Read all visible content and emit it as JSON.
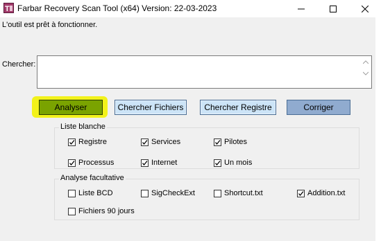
{
  "window": {
    "title": "Farbar Recovery Scan Tool (x64) Version: 22-03-2023",
    "icon": "frst-app-icon",
    "controls": [
      "minimize-icon",
      "maximize-icon",
      "close-icon"
    ]
  },
  "status_text": "L'outil est prêt à fonctionner.",
  "search": {
    "label": "Chercher:",
    "value": ""
  },
  "buttons": {
    "scan": "Analyser",
    "search_files": "Chercher Fichiers",
    "search_registry": "Chercher Registre",
    "fix": "Corriger"
  },
  "whitelist": {
    "title": "Liste blanche",
    "items": [
      {
        "label": "Registre",
        "checked": true
      },
      {
        "label": "Services",
        "checked": true
      },
      {
        "label": "Pilotes",
        "checked": true
      },
      {
        "label": "Processus",
        "checked": true
      },
      {
        "label": "Internet",
        "checked": true
      },
      {
        "label": "Un mois",
        "checked": true
      }
    ]
  },
  "optional_scan": {
    "title": "Analyse facultative",
    "items": [
      {
        "label": "Liste BCD",
        "checked": false
      },
      {
        "label": "SigCheckExt",
        "checked": false
      },
      {
        "label": "Shortcut.txt",
        "checked": false
      },
      {
        "label": "Addition.txt",
        "checked": true
      },
      {
        "label": "Fichiers 90 jours",
        "checked": false
      }
    ]
  },
  "colors": {
    "scan_button": "#7aa300",
    "highlight": "#f2f21b",
    "button_blue": "#cce4f7",
    "fix_button": "#90abcf"
  }
}
